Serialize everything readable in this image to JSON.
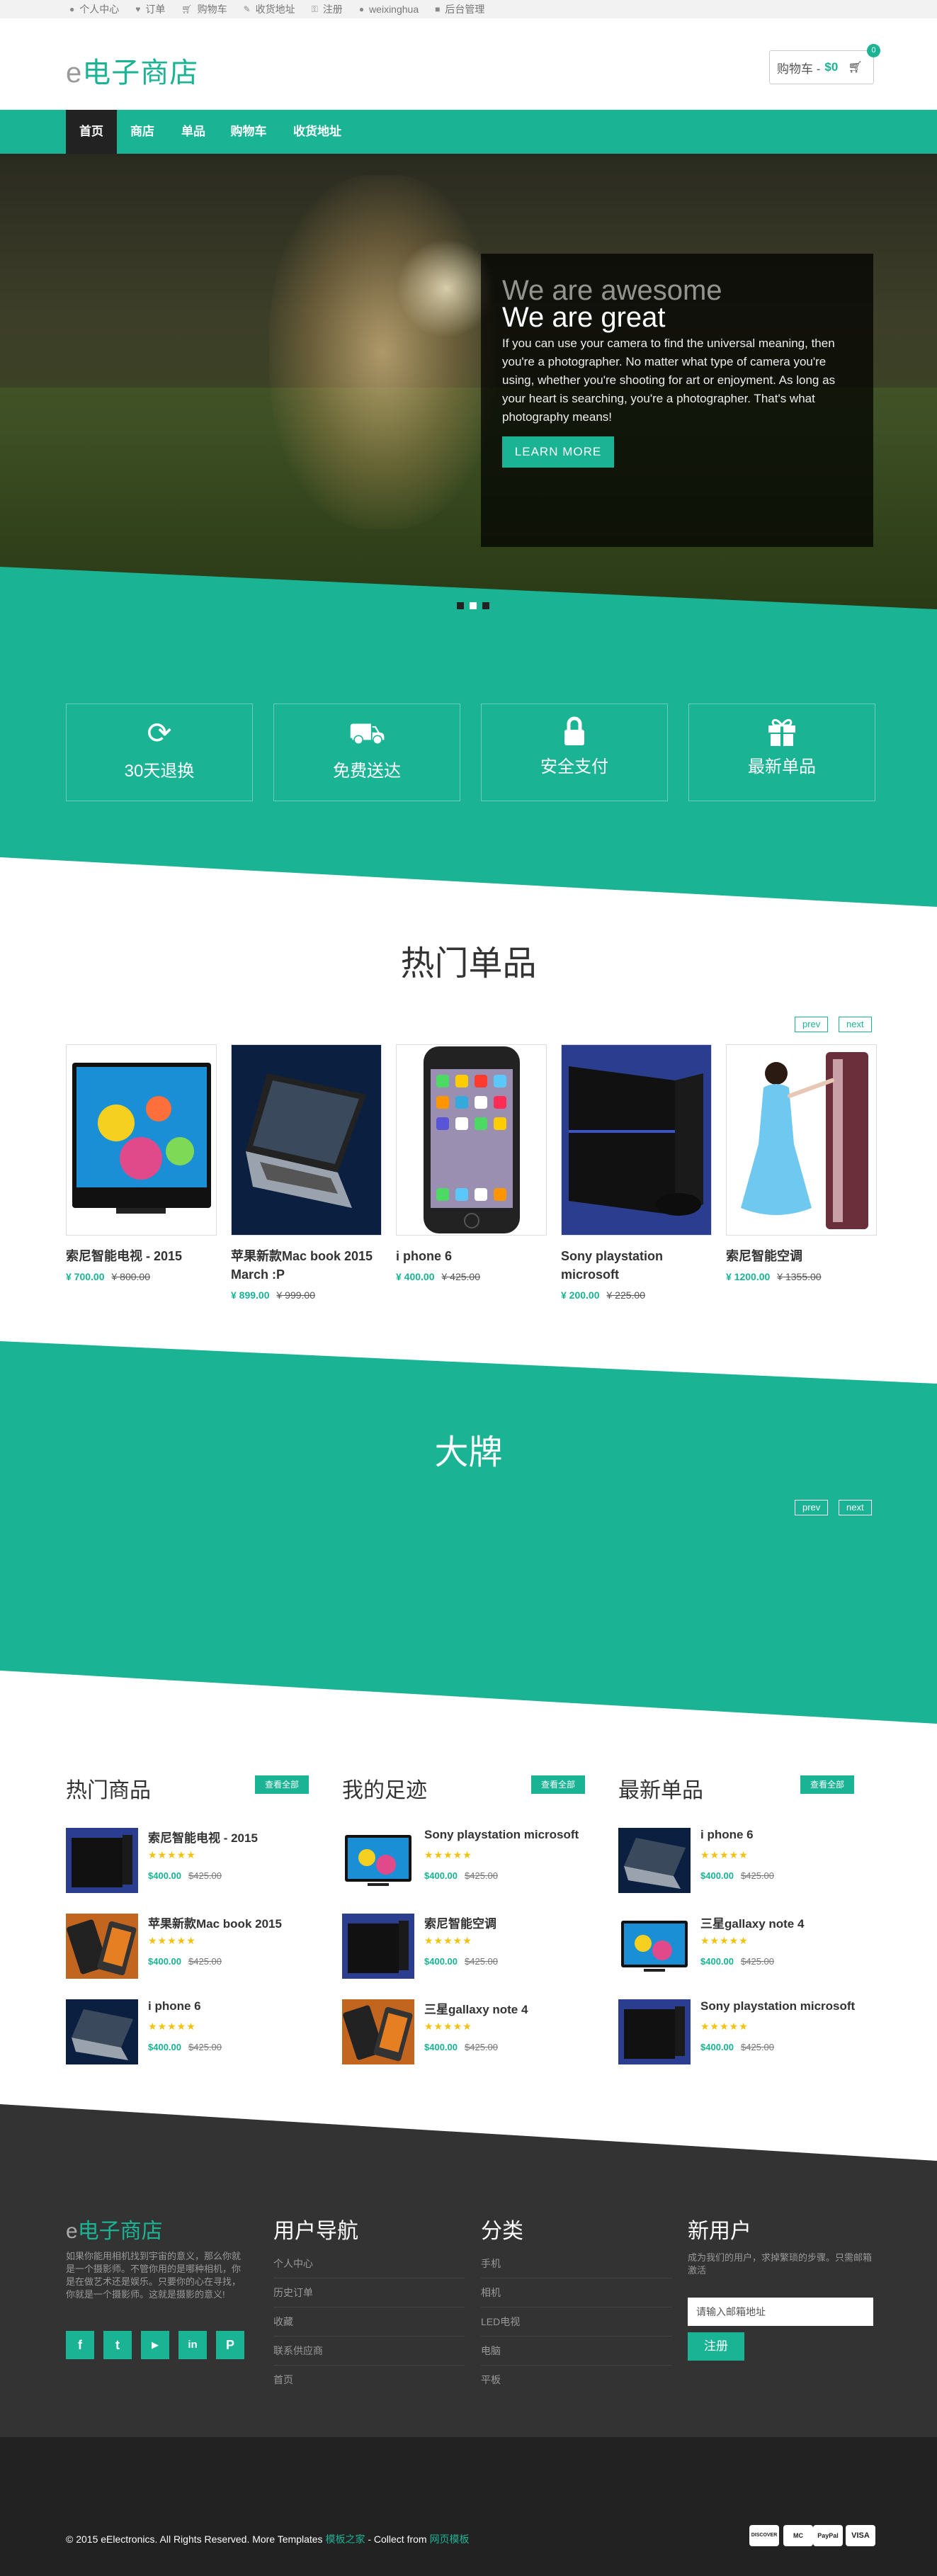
{
  "topbar": {
    "items": [
      {
        "icon": "user-icon",
        "label": "个人中心"
      },
      {
        "icon": "heart-icon",
        "label": "订单"
      },
      {
        "icon": "cart-icon",
        "label": "购物车"
      },
      {
        "icon": "pencil-icon",
        "label": "收货地址"
      },
      {
        "icon": "key-icon",
        "label": "注册"
      },
      {
        "icon": "user-icon",
        "label": "weixinghua"
      },
      {
        "icon": "lock-icon",
        "label": "后台管理"
      }
    ]
  },
  "header": {
    "logo_e": "e",
    "logo_text": "电子商店",
    "cart_label": "购物车 -",
    "cart_amount": "$0",
    "cart_count": "0"
  },
  "nav": {
    "items": [
      "首页",
      "商店",
      "单品",
      "购物车",
      "收货地址"
    ],
    "active": "首页"
  },
  "hero": {
    "title1": "We are awesome",
    "title2": "We are great",
    "text": "If you can use your camera to find the universal meaning, then you're a photographer. No matter what type of camera you're using, whether you're shooting for art or enjoyment. As long as your heart is searching, you're a photographer. That's what photography means!",
    "button": "LEARN MORE"
  },
  "features": [
    {
      "icon": "refresh-icon",
      "label": "30天退换"
    },
    {
      "icon": "truck-icon",
      "label": "免费送达"
    },
    {
      "icon": "lock-icon",
      "label": "安全支付"
    },
    {
      "icon": "gift-icon",
      "label": "最新单品"
    }
  ],
  "hot": {
    "title": "热门单品",
    "prev": "prev",
    "next": "next",
    "products": [
      {
        "name": "索尼智能电视 - 2015",
        "price": "¥ 700.00",
        "old": "¥ 800.00",
        "image": "tv-image"
      },
      {
        "name": "苹果新款Mac book 2015 March :P",
        "price": "¥ 899.00",
        "old": "¥ 999.00",
        "image": "laptop-image"
      },
      {
        "name": "i phone 6",
        "price": "¥ 400.00",
        "old": "¥ 425.00",
        "image": "phone-image"
      },
      {
        "name": "Sony playstation microsoft",
        "price": "¥ 200.00",
        "old": "¥ 225.00",
        "image": "console-image"
      },
      {
        "name": "索尼智能空调",
        "price": "¥ 1200.00",
        "old": "¥ 1355.00",
        "image": "air-conditioner-image"
      }
    ]
  },
  "brands": {
    "title": "大牌",
    "prev": "prev",
    "next": "next"
  },
  "columns": [
    {
      "title": "热门商品",
      "all": "查看全部",
      "items": [
        {
          "name": "索尼智能电视 - 2015",
          "price": "$400.00",
          "old": "$425.00",
          "image": "console-image"
        },
        {
          "name": "苹果新款Mac book 2015",
          "price": "$400.00",
          "old": "$425.00",
          "image": "tablet-image"
        },
        {
          "name": "i phone 6",
          "price": "$400.00",
          "old": "$425.00",
          "image": "laptop-image"
        }
      ]
    },
    {
      "title": "我的足迹",
      "all": "查看全部",
      "items": [
        {
          "name": "Sony playstation microsoft",
          "price": "$400.00",
          "old": "$425.00",
          "image": "tv-image"
        },
        {
          "name": "索尼智能空调",
          "price": "$400.00",
          "old": "$425.00",
          "image": "console-image"
        },
        {
          "name": "三星gallaxy note 4",
          "price": "$400.00",
          "old": "$425.00",
          "image": "tablet-image"
        }
      ]
    },
    {
      "title": "最新单品",
      "all": "查看全部",
      "items": [
        {
          "name": "i phone 6",
          "price": "$400.00",
          "old": "$425.00",
          "image": "laptop-image"
        },
        {
          "name": "三星gallaxy note 4",
          "price": "$400.00",
          "old": "$425.00",
          "image": "tv-image"
        },
        {
          "name": "Sony playstation microsoft",
          "price": "$400.00",
          "old": "$425.00",
          "image": "console-image"
        }
      ]
    }
  ],
  "stars": "★★★★★",
  "footer": {
    "logo_e": "e",
    "logo_text": "电子商店",
    "about": "如果你能用相机找到宇宙的意义，那么你就是一个摄影师。不管你用的是哪种相机，你是在做艺术还是娱乐。只要你的心在寻找，你就是一个摄影师。这就是摄影的意义!",
    "social": [
      "f",
      "t",
      "yt",
      "in",
      "p"
    ],
    "nav_title": "用户导航",
    "nav_links": [
      "个人中心",
      "历史订单",
      "收藏",
      "联系供应商",
      "首页"
    ],
    "cat_title": "分类",
    "cat_links": [
      "手机",
      "相机",
      "LED电视",
      "电脑",
      "平板"
    ],
    "new_title": "新用户",
    "new_text": "成为我们的用户，求掉繁琐的步骤。只需邮箱激活",
    "email_placeholder": "请输入邮箱地址",
    "register": "注册",
    "copy_text": "© 2015 eElectronics. All Rights Reserved. More Templates ",
    "copy_link1": "模板之家",
    "copy_mid": " - Collect from ",
    "copy_link2": "网页模板",
    "payments": [
      "DISCOVER",
      "MC",
      "PayPal",
      "VISA"
    ]
  },
  "colors": {
    "accent": "#1ab394",
    "dark": "#333333",
    "darker": "#222222"
  }
}
